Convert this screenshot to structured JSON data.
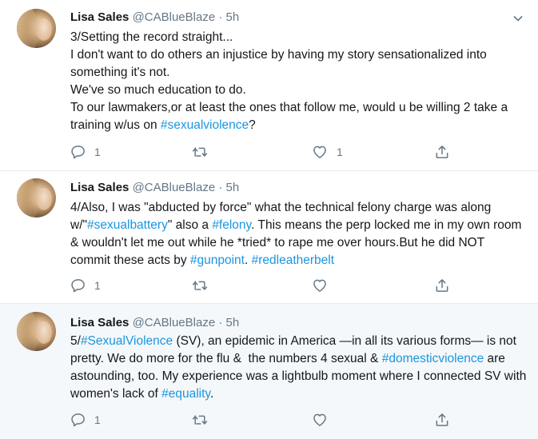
{
  "tweets": [
    {
      "author_name": "Lisa Sales",
      "handle_time": "@CABlueBlaze · 5h",
      "text_segments": [
        {
          "t": "3/Setting the record straight...\nI don't want to do others an injustice by having my story sensationalized into something it's not.\nWe've so much education to do.\nTo our lawmakers,or at least the ones that follow me, would u be willing 2 take a training w/us on ",
          "tag": false
        },
        {
          "t": "#sexualviolence",
          "tag": true
        },
        {
          "t": "?",
          "tag": false
        }
      ],
      "reply_count": "1",
      "retweet_count": "",
      "like_count": "1"
    },
    {
      "author_name": "Lisa Sales",
      "handle_time": "@CABlueBlaze · 5h",
      "text_segments": [
        {
          "t": "4/Also, I was \"abducted by force\" what the technical felony charge was along w/\"",
          "tag": false
        },
        {
          "t": "#sexualbattery",
          "tag": true
        },
        {
          "t": "\" also a ",
          "tag": false
        },
        {
          "t": "#felony",
          "tag": true
        },
        {
          "t": ". This means the perp locked me in my own room & wouldn't let me out while he *tried* to rape me over hours.But he did NOT commit these acts by ",
          "tag": false
        },
        {
          "t": "#gunpoint",
          "tag": true
        },
        {
          "t": ". ",
          "tag": false
        },
        {
          "t": "#redleatherbelt",
          "tag": true
        }
      ],
      "reply_count": "1",
      "retweet_count": "",
      "like_count": ""
    },
    {
      "author_name": "Lisa Sales",
      "handle_time": "@CABlueBlaze · 5h",
      "text_segments": [
        {
          "t": "5/",
          "tag": false
        },
        {
          "t": "#SexualViolence",
          "tag": true
        },
        {
          "t": " (SV), an epidemic in America —in all its various forms— is not pretty. We do more for the flu &  the numbers 4 sexual & ",
          "tag": false
        },
        {
          "t": "#domesticviolence",
          "tag": true
        },
        {
          "t": " are astounding, too. My experience was a lightbulb moment where I connected SV with women's lack of ",
          "tag": false
        },
        {
          "t": "#equality",
          "tag": true
        },
        {
          "t": ".",
          "tag": false
        }
      ],
      "reply_count": "1",
      "retweet_count": "",
      "like_count": ""
    }
  ],
  "colors": {
    "link": "#1b95e0",
    "muted": "#657786",
    "text": "#14171a",
    "highlight_bg": "#f5f8fa"
  },
  "icons": {
    "reply": "reply-icon",
    "retweet": "retweet-icon",
    "like": "heart-icon",
    "share": "share-icon",
    "menu": "chevron-down-icon"
  }
}
